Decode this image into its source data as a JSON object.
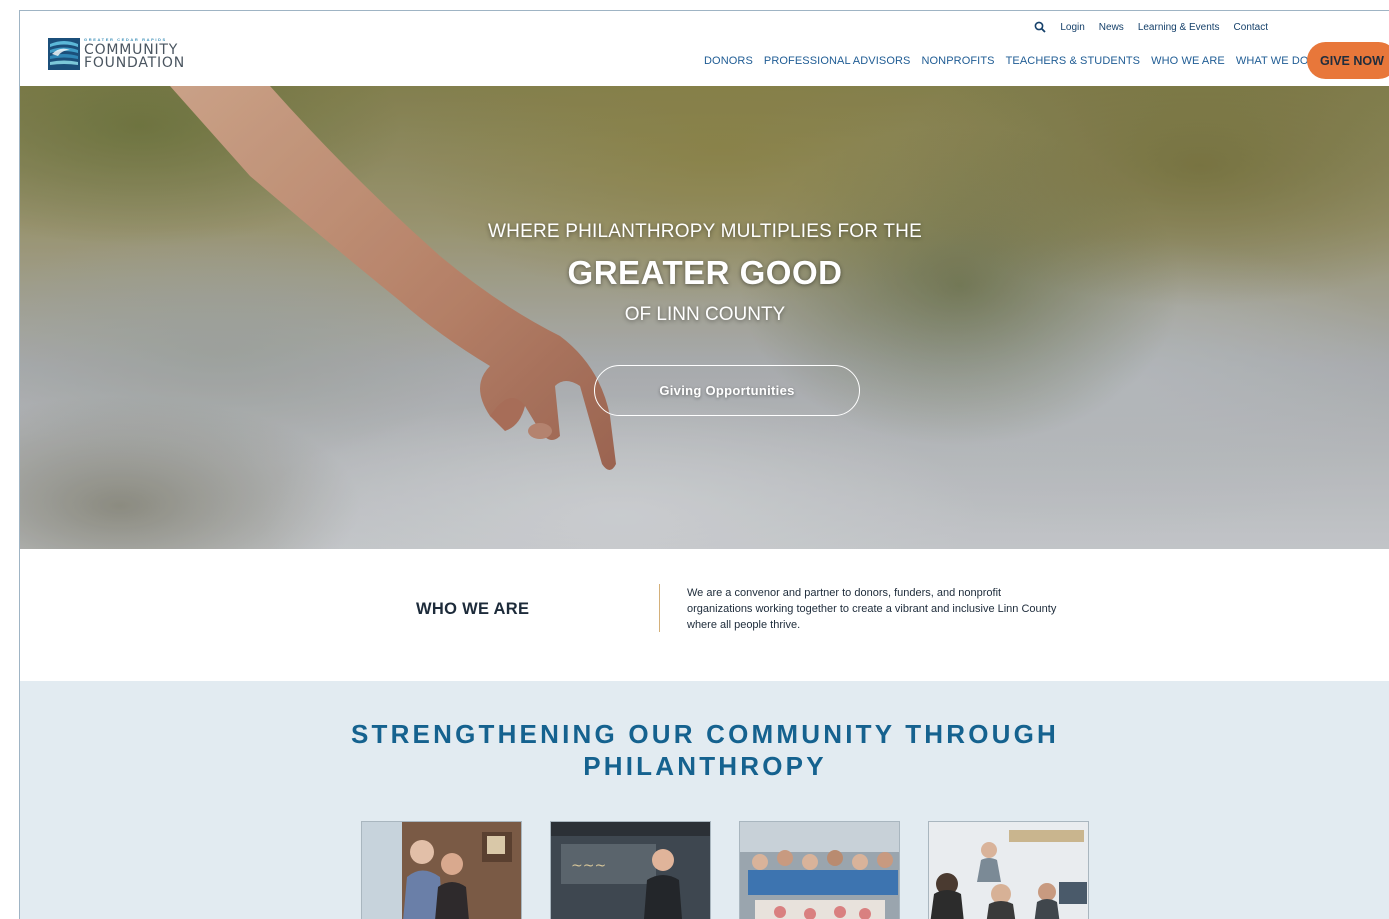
{
  "brand": {
    "tagline": "GREATER CEDAR RAPIDS",
    "name_line1": "COMMUNITY",
    "name_line2": "FOUNDATION",
    "colors": {
      "primary_blue": "#1f5c94",
      "accent_orange": "#e8773a",
      "light_bg": "#e2ebf1",
      "title_blue": "#15628f"
    }
  },
  "utility_nav": {
    "search_icon": "search-icon",
    "items": [
      "Login",
      "News",
      "Learning & Events",
      "Contact"
    ]
  },
  "main_nav": {
    "items": [
      "DONORS",
      "PROFESSIONAL ADVISORS",
      "NONPROFITS",
      "TEACHERS & STUDENTS",
      "WHO WE ARE",
      "WHAT WE DO"
    ],
    "cta": "GIVE NOW"
  },
  "hero": {
    "line1": "WHERE PHILANTHROPY MULTIPLIES FOR THE",
    "line2": "GREATER GOOD",
    "line3": "OF LINN COUNTY",
    "button": "Giving Opportunities"
  },
  "who_we_are": {
    "title": "WHO WE ARE",
    "body": "We are a convenor and partner to donors, funders, and nonprofit organizations working together to create a vibrant and inclusive Linn County where all people thrive."
  },
  "strengthening": {
    "title_line1": "STRENGTHENING OUR COMMUNITY THROUGH",
    "title_line2": "PHILANTHROPY",
    "cards": [
      "card-donors-photo",
      "card-nonprofit-photo",
      "card-volunteers-photo",
      "card-students-photo"
    ]
  }
}
